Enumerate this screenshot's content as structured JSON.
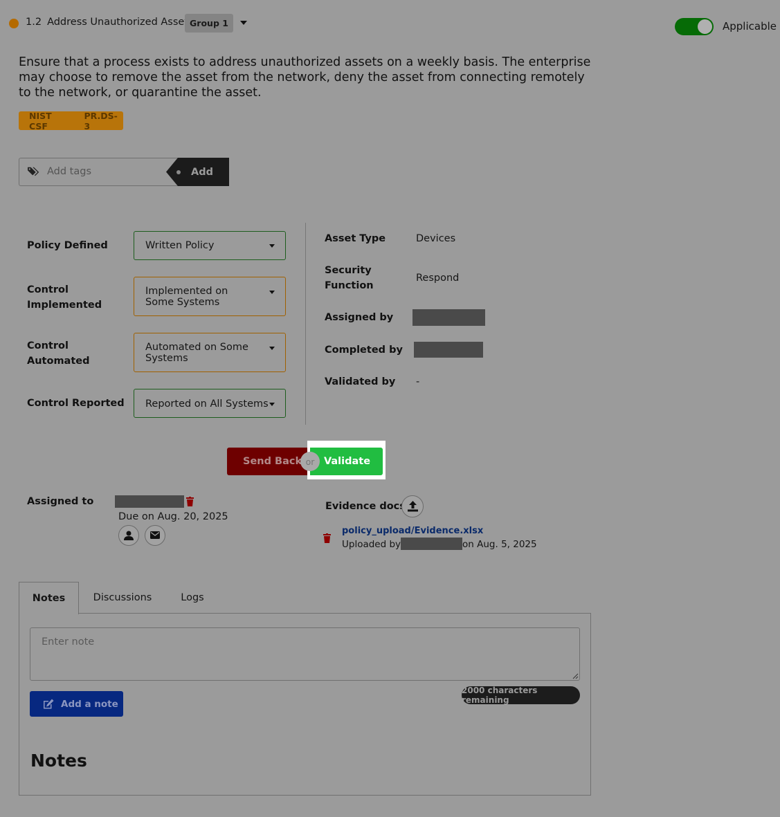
{
  "control": {
    "status_color": "#b46a00",
    "number": "1.2",
    "title": "Address Unauthorized Assets",
    "group": "Group 1",
    "applicable_label": "Applicable",
    "applicable_on": true,
    "description": "Ensure that a process exists to address unauthorized assets on a weekly basis. The enterprise may choose to remove the asset from the network, deny the asset from connecting remotely to the network, or quarantine the asset.",
    "framework": "NIST CSF",
    "framework_ref": "PR.DS-3"
  },
  "tags": {
    "placeholder": "Add tags",
    "add_label": "Add",
    "icon": "tags-icon"
  },
  "form": {
    "policy_defined": {
      "label": "Policy Defined",
      "value": "Written Policy"
    },
    "control_implemented": {
      "label": "Control Implemented",
      "value": "Implemented on Some Systems"
    },
    "control_automated": {
      "label": "Control Automated",
      "value": "Automated on Some Systems"
    },
    "control_reported": {
      "label": "Control Reported",
      "value": "Reported on All Systems"
    }
  },
  "meta": {
    "asset_type_label": "Asset Type",
    "asset_type": "Devices",
    "security_function_label": "Security Function",
    "security_function": "Respond",
    "assigned_by_label": "Assigned by",
    "completed_by_label": "Completed by",
    "validated_by_label": "Validated by",
    "validated_by": "-"
  },
  "actions": {
    "send_back": "Send Back",
    "or": "or",
    "validate": "Validate"
  },
  "assignment": {
    "label": "Assigned to",
    "due": "Due on Aug. 20, 2025"
  },
  "evidence": {
    "label": "Evidence docs",
    "file": "policy_upload/Evidence.xlsx",
    "uploaded_by_prefix": "Uploaded by",
    "uploaded_on": "on Aug. 5, 2025"
  },
  "tabs": [
    "Notes",
    "Discussions",
    "Logs"
  ],
  "notes": {
    "placeholder": "Enter note",
    "add_label": "Add a note",
    "chars_remaining": "2000 characters remaining",
    "heading": "Notes"
  },
  "colors": {
    "validate": "#21bd41",
    "send_back": "#6e0000",
    "add_note": "#072880",
    "toggle_on": "#066b06"
  }
}
